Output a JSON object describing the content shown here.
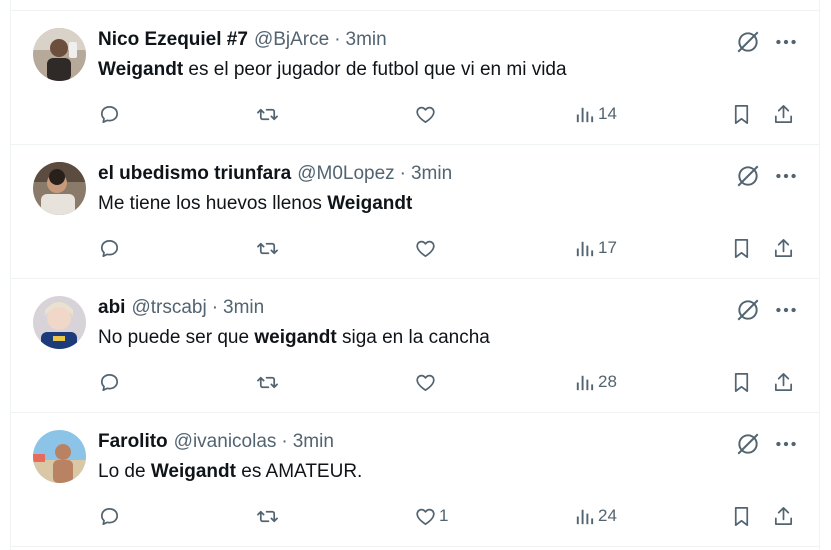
{
  "tweets": [
    {
      "name": "Nico Ezequiel #7",
      "handle": "@BjArce",
      "separator": "·",
      "time": "3min",
      "text_bold": "Weigandt",
      "text_rest": " es el peor jugador de futbol que vi en mi vida",
      "text_pre": "",
      "replies": "",
      "retweets": "",
      "likes": "",
      "views": "14"
    },
    {
      "name": "el ubedismo triunfara",
      "handle": "@M0Lopez",
      "separator": "·",
      "time": "3min",
      "text_pre": "Me tiene los huevos llenos ",
      "text_bold": "Weigandt",
      "text_rest": "",
      "replies": "",
      "retweets": "",
      "likes": "",
      "views": "17"
    },
    {
      "name": "abi",
      "handle": "@trscabj",
      "separator": "·",
      "time": "3min",
      "text_pre": "No puede ser que ",
      "text_bold": "weigandt",
      "text_rest": " siga en la cancha",
      "replies": "",
      "retweets": "",
      "likes": "",
      "views": "28"
    },
    {
      "name": "Farolito",
      "handle": "@ivanicolas",
      "separator": "·",
      "time": "3min",
      "text_pre": "Lo de ",
      "text_bold": "Weigandt",
      "text_rest": " es AMATEUR.",
      "replies": "",
      "retweets": "",
      "likes": "1",
      "views": "24"
    }
  ],
  "icons": {
    "reply": "reply-icon",
    "retweet": "retweet-icon",
    "like": "heart-icon",
    "views": "views-icon",
    "bookmark": "bookmark-icon",
    "share": "share-icon",
    "grok": "grok-icon",
    "more": "more-icon"
  },
  "colors": {
    "text": "#0f1419",
    "secondary": "#536471",
    "divider": "#eff3f4",
    "background": "#ffffff"
  }
}
